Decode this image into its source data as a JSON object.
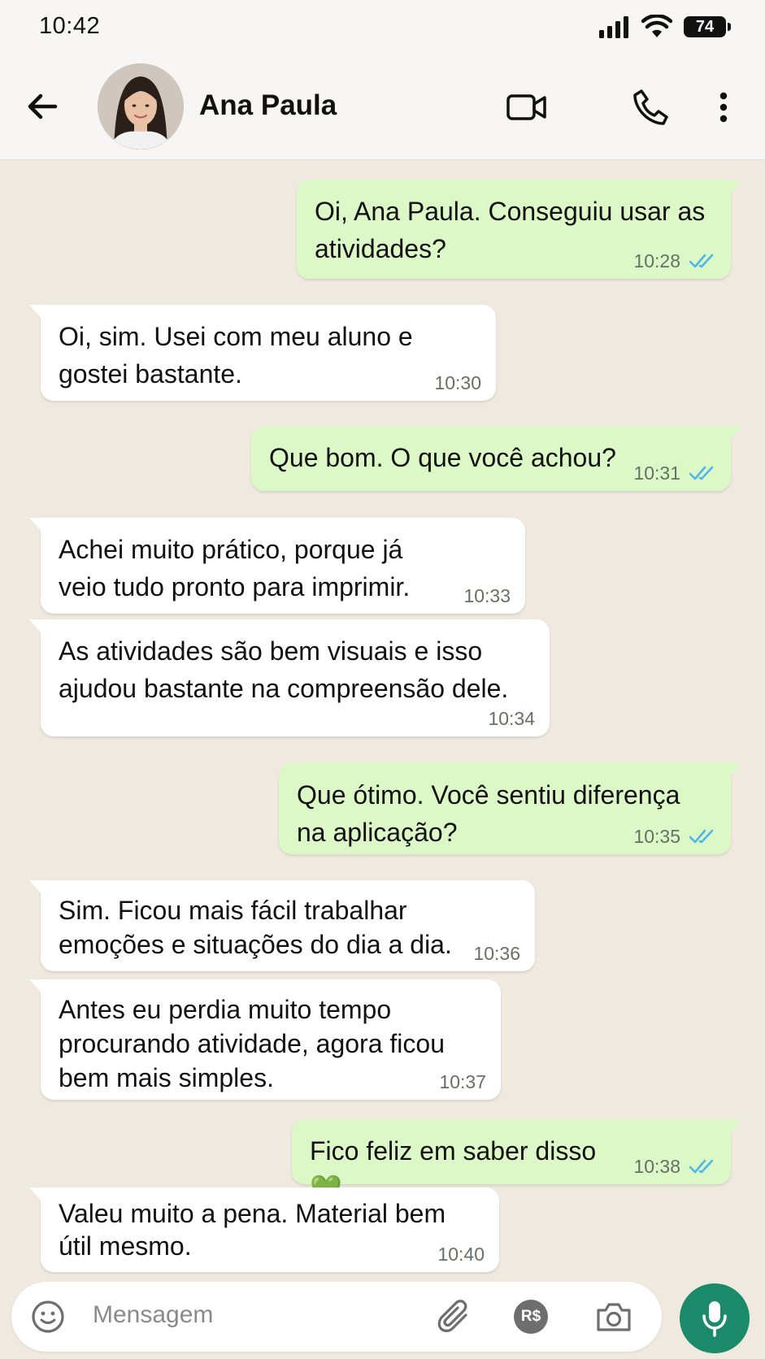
{
  "status_bar": {
    "time": "10:42",
    "battery": "74"
  },
  "header": {
    "contact_name": "Ana Paula"
  },
  "messages": [
    {
      "dir": "out",
      "text": "Oi, Ana Paula. Conseguiu usar as atividades?",
      "time": "10:28",
      "read": true
    },
    {
      "dir": "in",
      "text": "Oi, sim. Usei com meu aluno e gostei bastante.",
      "time": "10:30"
    },
    {
      "dir": "out",
      "text": "Que bom. O que você achou?",
      "time": "10:31",
      "read": true
    },
    {
      "dir": "in",
      "text": "Achei muito prático, porque já veio tudo pronto para imprimir.",
      "time": "10:33"
    },
    {
      "dir": "in",
      "text": "As atividades são bem visuais e isso ajudou bastante na compreensão dele.",
      "time": "10:34"
    },
    {
      "dir": "out",
      "text": "Que ótimo. Você sentiu diferença na aplicação?",
      "time": "10:35",
      "read": true
    },
    {
      "dir": "in",
      "text": "Sim. Ficou mais fácil trabalhar emoções e situações do dia a dia.",
      "time": "10:36"
    },
    {
      "dir": "in",
      "text": "Antes eu perdia muito tempo procurando atividade, agora ficou bem mais simples.",
      "time": "10:37"
    },
    {
      "dir": "out",
      "text": "Fico feliz em saber disso 💚",
      "time": "10:38",
      "read": true
    },
    {
      "dir": "in",
      "text": "Valeu muito a pena. Material bem útil mesmo.",
      "time": "10:40"
    }
  ],
  "composer": {
    "placeholder": "Mensagem",
    "payment_label": "R$"
  },
  "icons": {
    "back": "arrow-left-icon",
    "video": "video-camera-icon",
    "call": "phone-icon",
    "menu": "more-vertical-icon",
    "emoji": "emoji-icon",
    "attach": "paperclip-icon",
    "camera": "camera-icon",
    "mic": "microphone-icon"
  },
  "colors": {
    "outgoing_bubble": "#dcf8c6",
    "incoming_bubble": "#ffffff",
    "read_ticks": "#4fb6ec",
    "mic_button": "#1a8a6b"
  }
}
